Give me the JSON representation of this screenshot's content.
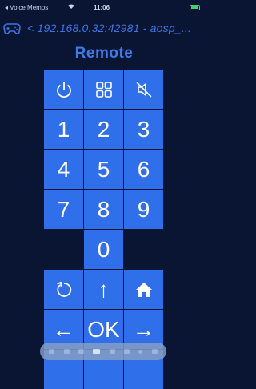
{
  "status_bar": {
    "carrier": "◂ Voice Memos",
    "time": "11:06"
  },
  "header": {
    "connection_label": "< 192.168.0.32:42981 - aosp_..."
  },
  "title": "Remote",
  "keypad": {
    "power": "power-icon",
    "apps": "apps-grid-icon",
    "mute": "mute-icon",
    "d1": "1",
    "d2": "2",
    "d3": "3",
    "d4": "4",
    "d5": "5",
    "d6": "6",
    "d7": "7",
    "d8": "8",
    "d9": "9",
    "d0": "0",
    "back": "back-icon",
    "up": "↑",
    "home": "home-icon",
    "left": "←",
    "ok": "OK",
    "right": "→"
  },
  "dock": {
    "items": [
      "app-1",
      "app-2",
      "app-3",
      "app-4",
      "app-5",
      "app-6",
      "app-7",
      "app-8"
    ]
  },
  "colors": {
    "background": "#0a1533",
    "button": "#2f6fea",
    "accent_text": "#3d7bea"
  }
}
